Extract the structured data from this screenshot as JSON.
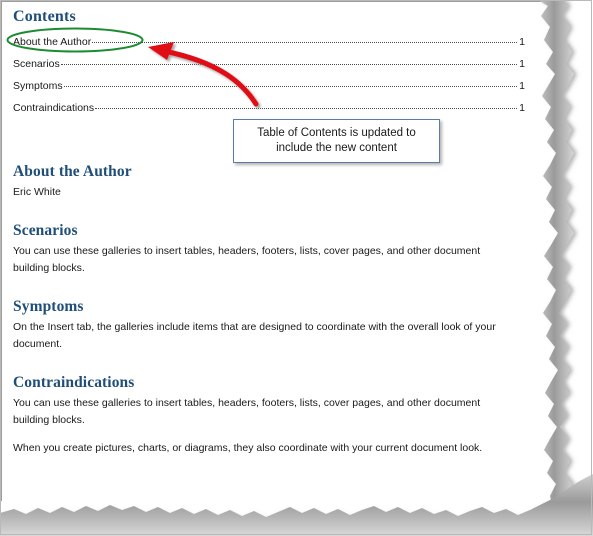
{
  "document": {
    "contents_heading": "Contents",
    "toc": [
      {
        "label": "About the Author",
        "page": "1"
      },
      {
        "label": "Scenarios",
        "page": "1"
      },
      {
        "label": "Symptoms",
        "page": "1"
      },
      {
        "label": "Contraindications",
        "page": "1"
      }
    ],
    "sections": [
      {
        "heading": "About the Author",
        "paragraphs": [
          "Eric White"
        ]
      },
      {
        "heading": "Scenarios",
        "paragraphs": [
          "You can use these galleries to insert tables, headers, footers, lists, cover pages, and other document building blocks."
        ]
      },
      {
        "heading": "Symptoms",
        "paragraphs": [
          "On the Insert tab, the galleries include items that are designed to coordinate with the overall look of your document."
        ]
      },
      {
        "heading": "Contraindications",
        "paragraphs": [
          "You can use these galleries to insert tables, headers, footers, lists, cover pages, and other document building blocks.",
          "When you create pictures, charts, or diagrams, they also coordinate with your current document look."
        ]
      }
    ]
  },
  "annotations": {
    "callout_text_line1": "Table of Contents is updated to",
    "callout_text_line2": "include the new content",
    "highlight_target": "About the Author",
    "colors": {
      "heading_blue": "#1F4E79",
      "ellipse_green": "#1E8B33",
      "arrow_red": "#E00B16",
      "callout_border": "#5A7CA6",
      "torn_edge_gray": "#8C8C8C"
    }
  }
}
